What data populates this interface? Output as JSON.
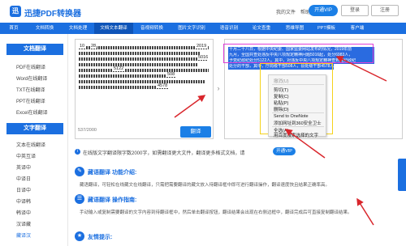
{
  "brand": {
    "logo_letter": "迅",
    "name": "迅捷PDF转换器"
  },
  "topbar": {
    "links": [
      "我的文件",
      "帮助"
    ],
    "vip_label": "开通VIP",
    "login_label": "登录",
    "register_label": "注册"
  },
  "nav": {
    "items": [
      "首页",
      "文档转换",
      "文档处理",
      "文档文本翻译",
      "音视频转换",
      "图片文字识别",
      "语音识别",
      "论文查重",
      "思维导图",
      "PPT模板",
      "客户端"
    ]
  },
  "sidebar": {
    "sections": [
      {
        "title": "文档翻译",
        "items": [
          "PDF在线翻译",
          "Word在线翻译",
          "TXT在线翻译",
          "PPT在线翻译",
          "Excel在线翻译"
        ]
      },
      {
        "title": "文字翻译",
        "items": [
          "文本在线翻译",
          "中英互译",
          "英译中",
          "中译日",
          "日译中",
          "中译韩",
          "韩译中",
          "汉译藏",
          "藏译汉"
        ]
      }
    ]
  },
  "source": {
    "numbers": [
      "10",
      "28",
      "2019",
      "5016",
      "5122",
      "508",
      "4578"
    ],
    "counter": "537/2000",
    "translate_label": "翻译"
  },
  "target": {
    "lines": [
      "十月二十八日，根据中央纪委、国家监委网站发布的情况，2019年前",
      "九月，全国共查处违反中央八项规定精神问题5016起，处分6983人，",
      "予党纪政纪处分5122人。其中，对违反中央八项规定精神查到党纪政纪",
      "处分的干部，其中，厅局级干部508人，县处级干部4578人。"
    ]
  },
  "context_menu": {
    "items": [
      "撤消(U)",
      "剪切(T)",
      "复制(C)",
      "粘贴(P)",
      "删除(D)",
      "Send to OneNote",
      "添加网址到360安全卫士",
      "全选(A)",
      "用百度搜索选择的文字"
    ]
  },
  "notice": {
    "icon": "info-icon",
    "text": "在线版文字翻译限字数2000字，如需翻译更大文件，翻译更多格式文档，请",
    "vip_label": "开通VIP"
  },
  "sections": [
    {
      "title": "藏语翻译 功能介绍:",
      "text": "藏语翻译，可轻松在线藏文在线翻译，只需把需要翻译的藏文放入待翻译框中即可进行翻译操作，翻译速度快且结果正确率高。"
    },
    {
      "title": "藏语翻译 操作指南:",
      "text": "手动输入或复制需要翻译的文字内容到待翻译框中，然后单击翻译按钮，翻译结果会出现在右侧边框中，翻译完成后可直接复制翻译结果。"
    },
    {
      "title": "友情提示:",
      "text": ""
    }
  ],
  "colors": {
    "brand_blue": "#1b6fe0",
    "highlight_pink": "#e040d8",
    "highlight_yellow": "#f5d21a",
    "arrow_red": "#d9262c"
  }
}
